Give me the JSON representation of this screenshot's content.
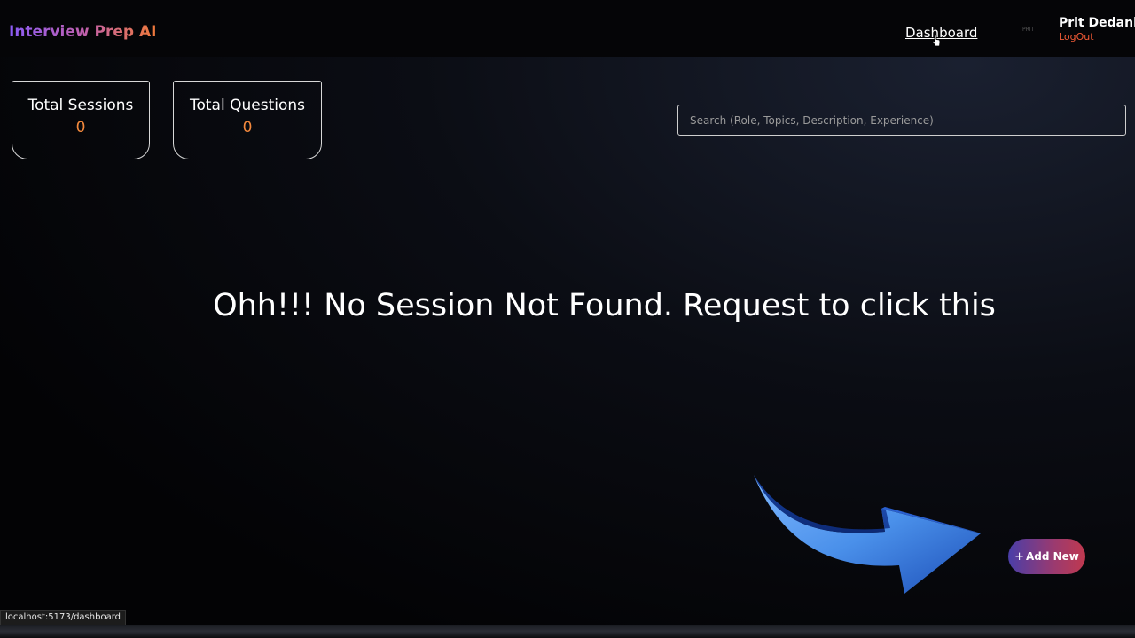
{
  "navbar": {
    "brand": "Interview Prep AI",
    "nav_link": "Dashboard",
    "avatar_text": "PRIT",
    "user_name": "Prit Dedaniya",
    "logout": "LogOut"
  },
  "stats": [
    {
      "label": "Total Sessions",
      "value": "0"
    },
    {
      "label": "Total Questions",
      "value": "0"
    }
  ],
  "search": {
    "placeholder": "Search (Role, Topics, Description, Experience)",
    "value": ""
  },
  "empty_message": "Ohh!!! No Session Not Found. Request to click this",
  "add_button": {
    "label": "Add New",
    "icon": "plus-icon"
  },
  "status_bar": {
    "url": "localhost:5173/dashboard"
  },
  "colors": {
    "accent_orange": "#f2883c",
    "logout_red": "#f25a35",
    "brand_gradient_start": "#8b5cf6",
    "brand_gradient_end": "#f07a3a",
    "arrow_blue": "#4a90ea"
  }
}
